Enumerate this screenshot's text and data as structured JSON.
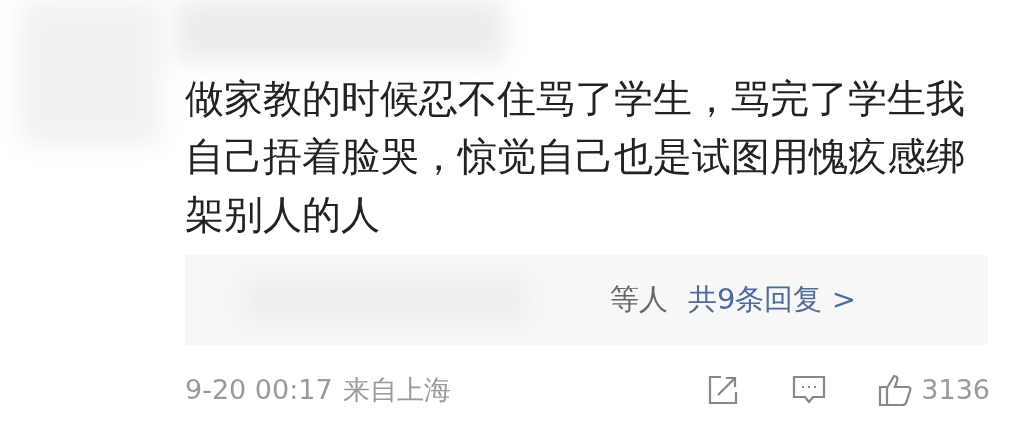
{
  "comment": {
    "text": "做家教的时候忍不住骂了学生，骂完了学生我自己捂着脸哭，惊觉自己也是试图用愧疚感绑架别人的人"
  },
  "replies": {
    "suffix": "等人",
    "link": "共9条回复 >"
  },
  "footer": {
    "time": "9-20 00:17",
    "location": "来自上海",
    "likes": "3136"
  }
}
